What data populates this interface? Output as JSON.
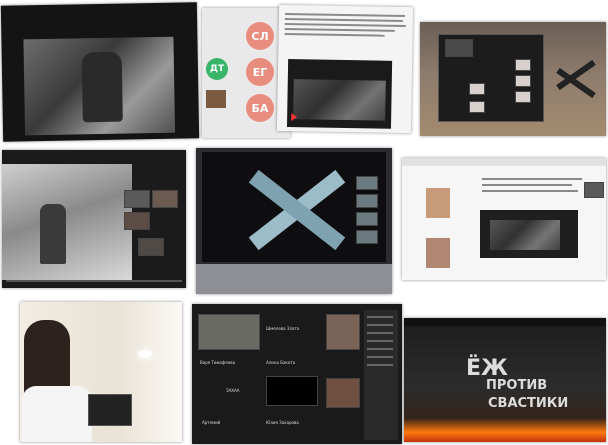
{
  "collage": {
    "tile2": {
      "avatars": [
        {
          "initials": "СЛ",
          "color": "#e88d7d"
        },
        {
          "initials": "ЕГ",
          "color": "#e88d7d"
        },
        {
          "initials": "БА",
          "color": "#e88d7d"
        },
        {
          "initials": "ДТ",
          "color": "#39b56a"
        }
      ]
    },
    "tile7": {
      "names": [
        "Варя Тимофеева",
        "Алина Бакота",
        "Шмелева Злата",
        "ЗАХАА",
        "Артемий",
        "Юлия Захарова"
      ]
    },
    "tile9": {
      "title_line1": "ЁЖ",
      "title_line2": "ПРОТИВ",
      "title_line3": "СВАСТИКИ"
    }
  }
}
